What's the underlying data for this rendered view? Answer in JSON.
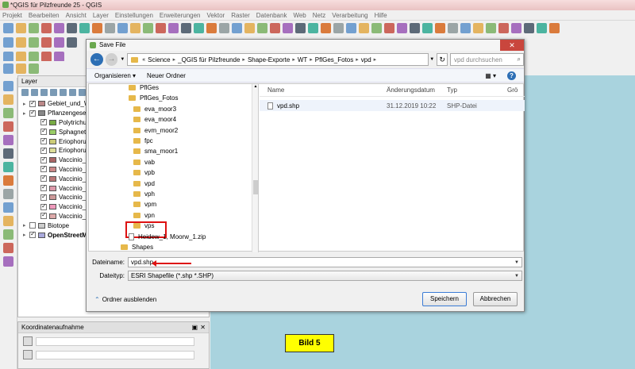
{
  "window": {
    "title": "*QGIS für Pilzfreunde 25 - QGIS"
  },
  "menu": [
    "Projekt",
    "Bearbeiten",
    "Ansicht",
    "Layer",
    "Einstellungen",
    "Erweiterungen",
    "Vektor",
    "Raster",
    "Datenbank",
    "Web",
    "Netz",
    "Verarbeitung",
    "Hilfe"
  ],
  "layers_panel": {
    "title": "Layer",
    "items": [
      {
        "label": "Gebiet_und_W",
        "checked": true,
        "color": "#b88",
        "indent": 1
      },
      {
        "label": "Pflanzengesell",
        "checked": true,
        "color": "#888",
        "indent": 1
      },
      {
        "label": "Polytrichum",
        "checked": true,
        "color": "#7a4",
        "indent": 2
      },
      {
        "label": "Sphagnetu",
        "checked": true,
        "color": "#9c6",
        "indent": 2
      },
      {
        "label": "Eriophorum",
        "checked": true,
        "color": "#cc7",
        "indent": 2
      },
      {
        "label": "Eriophorum",
        "checked": true,
        "color": "#dd9",
        "indent": 2
      },
      {
        "label": "Vaccinio_A",
        "checked": true,
        "color": "#a66",
        "indent": 2
      },
      {
        "label": "Vaccinio_u",
        "checked": true,
        "color": "#c88",
        "indent": 2
      },
      {
        "label": "Vaccinio_u",
        "checked": true,
        "color": "#b77",
        "indent": 2
      },
      {
        "label": "Vaccinio_u",
        "checked": true,
        "color": "#d9a",
        "indent": 2
      },
      {
        "label": "Vaccinio_u",
        "checked": true,
        "color": "#c99",
        "indent": 2
      },
      {
        "label": "Vaccinio_u",
        "checked": true,
        "color": "#e9b",
        "indent": 2
      },
      {
        "label": "Vaccinio_u",
        "checked": true,
        "color": "#daa",
        "indent": 2
      },
      {
        "label": "Biotope",
        "checked": false,
        "color": "#ccc",
        "indent": 1
      },
      {
        "label": "OpenStreetMa",
        "checked": true,
        "color": "#aad",
        "indent": 1
      }
    ]
  },
  "coord_panel": {
    "title": "Koordinatenaufnahme"
  },
  "map": {
    "label": "Bild 5",
    "background": "#a9d3de"
  },
  "dialog": {
    "title": "Save File",
    "breadcrumb": [
      "Science",
      "_QGIS für Pilzfreunde",
      "Shape-Exporte",
      "WT",
      "PflGes_Fotos",
      "vpd"
    ],
    "search_placeholder": "vpd durchsuchen",
    "organize": "Organisieren ▾",
    "new_folder": "Neuer Ordner",
    "tree": [
      {
        "label": "PflGes",
        "type": "folder",
        "indent": 1
      },
      {
        "label": "PflGes_Fotos",
        "type": "folder",
        "indent": 1
      },
      {
        "label": "eva_moor3",
        "type": "folder",
        "indent": 2
      },
      {
        "label": "eva_moor4",
        "type": "folder",
        "indent": 2
      },
      {
        "label": "evm_moor2",
        "type": "folder",
        "indent": 2
      },
      {
        "label": "fpc",
        "type": "folder",
        "indent": 2
      },
      {
        "label": "sma_moor1",
        "type": "folder",
        "indent": 2
      },
      {
        "label": "vab",
        "type": "folder",
        "indent": 2
      },
      {
        "label": "vpb",
        "type": "folder",
        "indent": 2
      },
      {
        "label": "vpd",
        "type": "folder",
        "indent": 2
      },
      {
        "label": "vph",
        "type": "folder",
        "indent": 2
      },
      {
        "label": "vpm",
        "type": "folder",
        "indent": 2
      },
      {
        "label": "vpn",
        "type": "folder",
        "indent": 2
      },
      {
        "label": "vps",
        "type": "folder",
        "indent": 2
      },
      {
        "label": "Heidew_1, Moorw_1.zip",
        "type": "file",
        "indent": 1
      },
      {
        "label": "Shapes",
        "type": "folder",
        "indent": 0
      }
    ],
    "columns": {
      "name": "Name",
      "date": "Änderungsdatum",
      "type": "Typ",
      "size": "Grö"
    },
    "files": [
      {
        "name": "vpd.shp",
        "date": "31.12.2019 10:22",
        "type": "SHP-Datei"
      }
    ],
    "filename_label": "Dateiname:",
    "filename_value": "vpd.shp",
    "filetype_label": "Dateityp:",
    "filetype_value": "ESRI Shapefile (*.shp *.SHP)",
    "hide_folders": "Ordner ausblenden",
    "save": "Speichern",
    "cancel": "Abbrechen"
  }
}
